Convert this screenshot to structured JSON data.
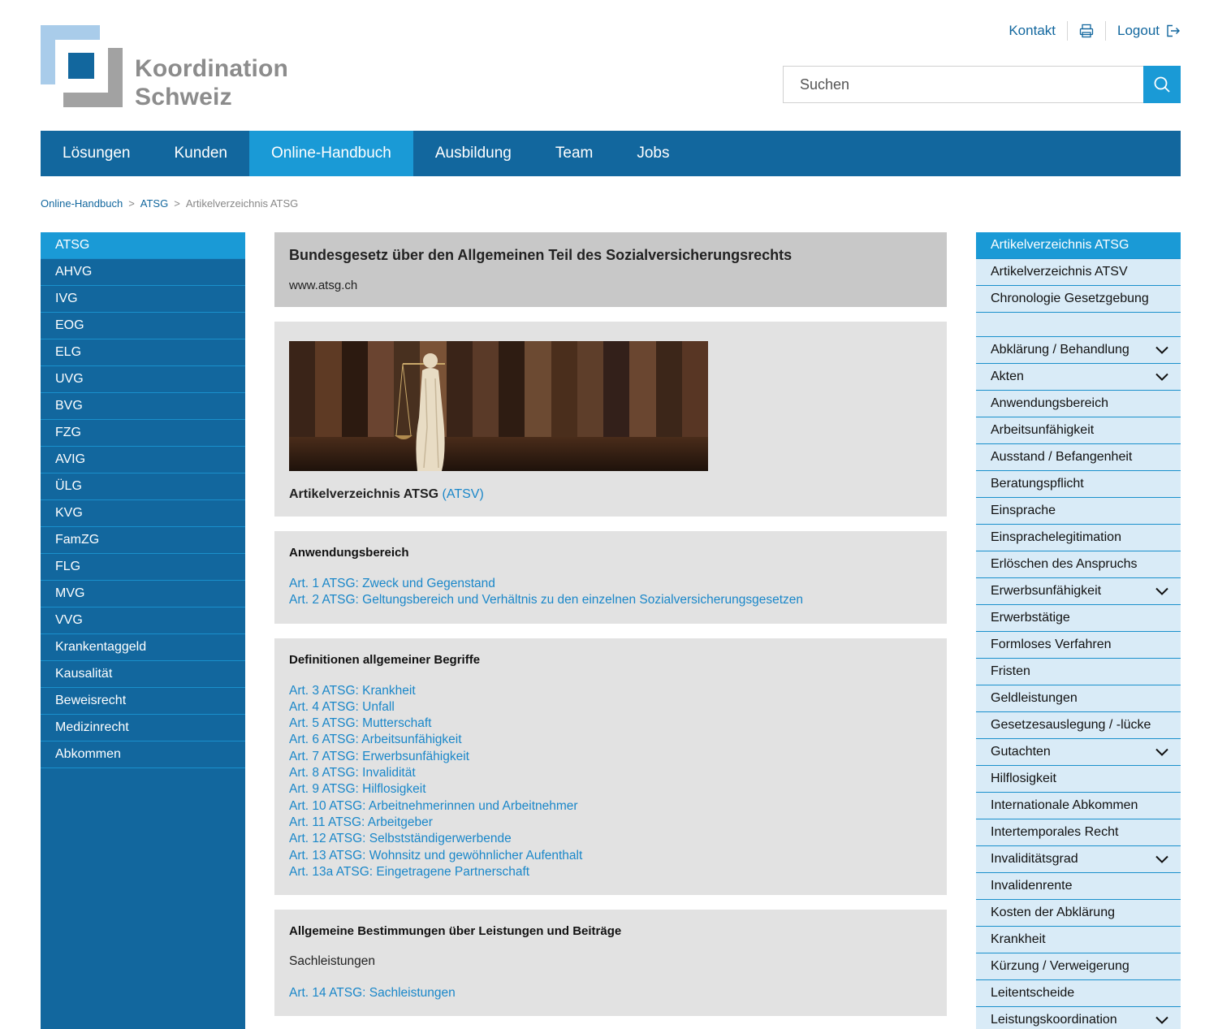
{
  "logo": {
    "line1": "Koordination",
    "line2": "Schweiz"
  },
  "toplinks": {
    "contact": "Kontakt",
    "logout": "Logout"
  },
  "search": {
    "placeholder": "Suchen"
  },
  "mainnav": [
    "Lösungen",
    "Kunden",
    "Online-Handbuch",
    "Ausbildung",
    "Team",
    "Jobs"
  ],
  "mainnav_active": 2,
  "breadcrumb": {
    "item1": "Online-Handbuch",
    "item2": "ATSG",
    "current": "Artikelverzeichnis ATSG"
  },
  "leftnav": [
    "ATSG",
    "AHVG",
    "IVG",
    "EOG",
    "ELG",
    "UVG",
    "BVG",
    "FZG",
    "AVIG",
    "ÜLG",
    "KVG",
    "FamZG",
    "FLG",
    "MVG",
    "VVG",
    "Krankentaggeld",
    "Kausalität",
    "Beweisrecht",
    "Medizinrecht",
    "Abkommen"
  ],
  "intro": {
    "title": "Bundesgesetz über den Allgemeinen Teil des Sozialversicherungsrechts",
    "url": "www.atsg.ch"
  },
  "imagebox": {
    "caption_bold": "Artikelverzeichnis ATSG",
    "caption_link": "(ATSV)"
  },
  "sections": [
    {
      "title": "Anwendungsbereich",
      "links": [
        "Art. 1 ATSG: Zweck und Gegenstand",
        "Art. 2 ATSG: Geltungsbereich und Verhältnis zu den einzelnen Sozialversicherungsgesetzen"
      ]
    },
    {
      "title": "Definitionen allgemeiner Begriffe",
      "links": [
        "Art. 3 ATSG: Krankheit",
        "Art. 4 ATSG: Unfall",
        "Art. 5 ATSG: Mutterschaft",
        "Art. 6 ATSG: Arbeitsunfähigkeit",
        "Art. 7 ATSG: Erwerbsunfähigkeit",
        "Art. 8 ATSG: Invalidität",
        "Art. 9 ATSG: Hilflosigkeit",
        "Art. 10 ATSG: Arbeitnehmerinnen und Arbeitnehmer",
        "Art. 11 ATSG: Arbeitgeber",
        "Art. 12 ATSG: Selbstständigerwerbende",
        "Art. 13 ATSG: Wohnsitz und gewöhnlicher Aufenthalt",
        "Art. 13a ATSG: Eingetragene Partnerschaft"
      ]
    },
    {
      "title": "Allgemeine Bestimmungen über Leistungen und Beiträge",
      "subtitle": "Sachleistungen",
      "links": [
        "Art. 14 ATSG: Sachleistungen"
      ]
    }
  ],
  "rightnav_top": [
    "Artikelverzeichnis ATSG",
    "Artikelverzeichnis ATSV",
    "Chronologie Gesetzgebung"
  ],
  "rightnav_topics": [
    {
      "label": "Abklärung / Behandlung",
      "expandable": true
    },
    {
      "label": "Akten",
      "expandable": true
    },
    {
      "label": "Anwendungsbereich",
      "expandable": false
    },
    {
      "label": "Arbeitsunfähigkeit",
      "expandable": false
    },
    {
      "label": "Ausstand / Befangenheit",
      "expandable": false
    },
    {
      "label": "Beratungspflicht",
      "expandable": false
    },
    {
      "label": "Einsprache",
      "expandable": false
    },
    {
      "label": "Einsprachelegitimation",
      "expandable": false
    },
    {
      "label": "Erlöschen des Anspruchs",
      "expandable": false
    },
    {
      "label": "Erwerbsunfähigkeit",
      "expandable": true
    },
    {
      "label": "Erwerbstätige",
      "expandable": false
    },
    {
      "label": "Formloses Verfahren",
      "expandable": false
    },
    {
      "label": "Fristen",
      "expandable": false
    },
    {
      "label": "Geldleistungen",
      "expandable": false
    },
    {
      "label": "Gesetzesauslegung / -lücke",
      "expandable": false
    },
    {
      "label": "Gutachten",
      "expandable": true
    },
    {
      "label": "Hilflosigkeit",
      "expandable": false
    },
    {
      "label": "Internationale Abkommen",
      "expandable": false
    },
    {
      "label": "Intertemporales Recht",
      "expandable": false
    },
    {
      "label": "Invaliditätsgrad",
      "expandable": true
    },
    {
      "label": "Invalidenrente",
      "expandable": false
    },
    {
      "label": "Kosten der Abklärung",
      "expandable": false
    },
    {
      "label": "Krankheit",
      "expandable": false
    },
    {
      "label": "Kürzung / Verweigerung",
      "expandable": false
    },
    {
      "label": "Leitentscheide",
      "expandable": false
    },
    {
      "label": "Leistungskoordination",
      "expandable": true
    }
  ],
  "colors": {
    "primary": "#12679e",
    "accent": "#1a9ad6",
    "link": "#1a87c9",
    "sidebar_bg": "#d9ebf7"
  }
}
